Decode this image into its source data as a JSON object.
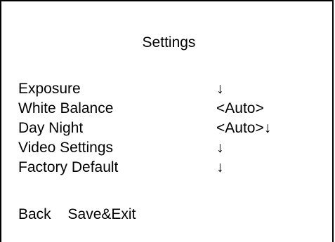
{
  "title": "Settings",
  "menu": {
    "items": [
      {
        "label": "Exposure",
        "value": "↓"
      },
      {
        "label": "White Balance",
        "value": "<Auto>"
      },
      {
        "label": "Day Night",
        "value": "<Auto>↓"
      },
      {
        "label": "Video Settings",
        "value": "↓"
      },
      {
        "label": "Factory Default",
        "value": "↓"
      }
    ]
  },
  "footer": {
    "back_label": "Back",
    "save_exit_label": "Save&Exit"
  }
}
